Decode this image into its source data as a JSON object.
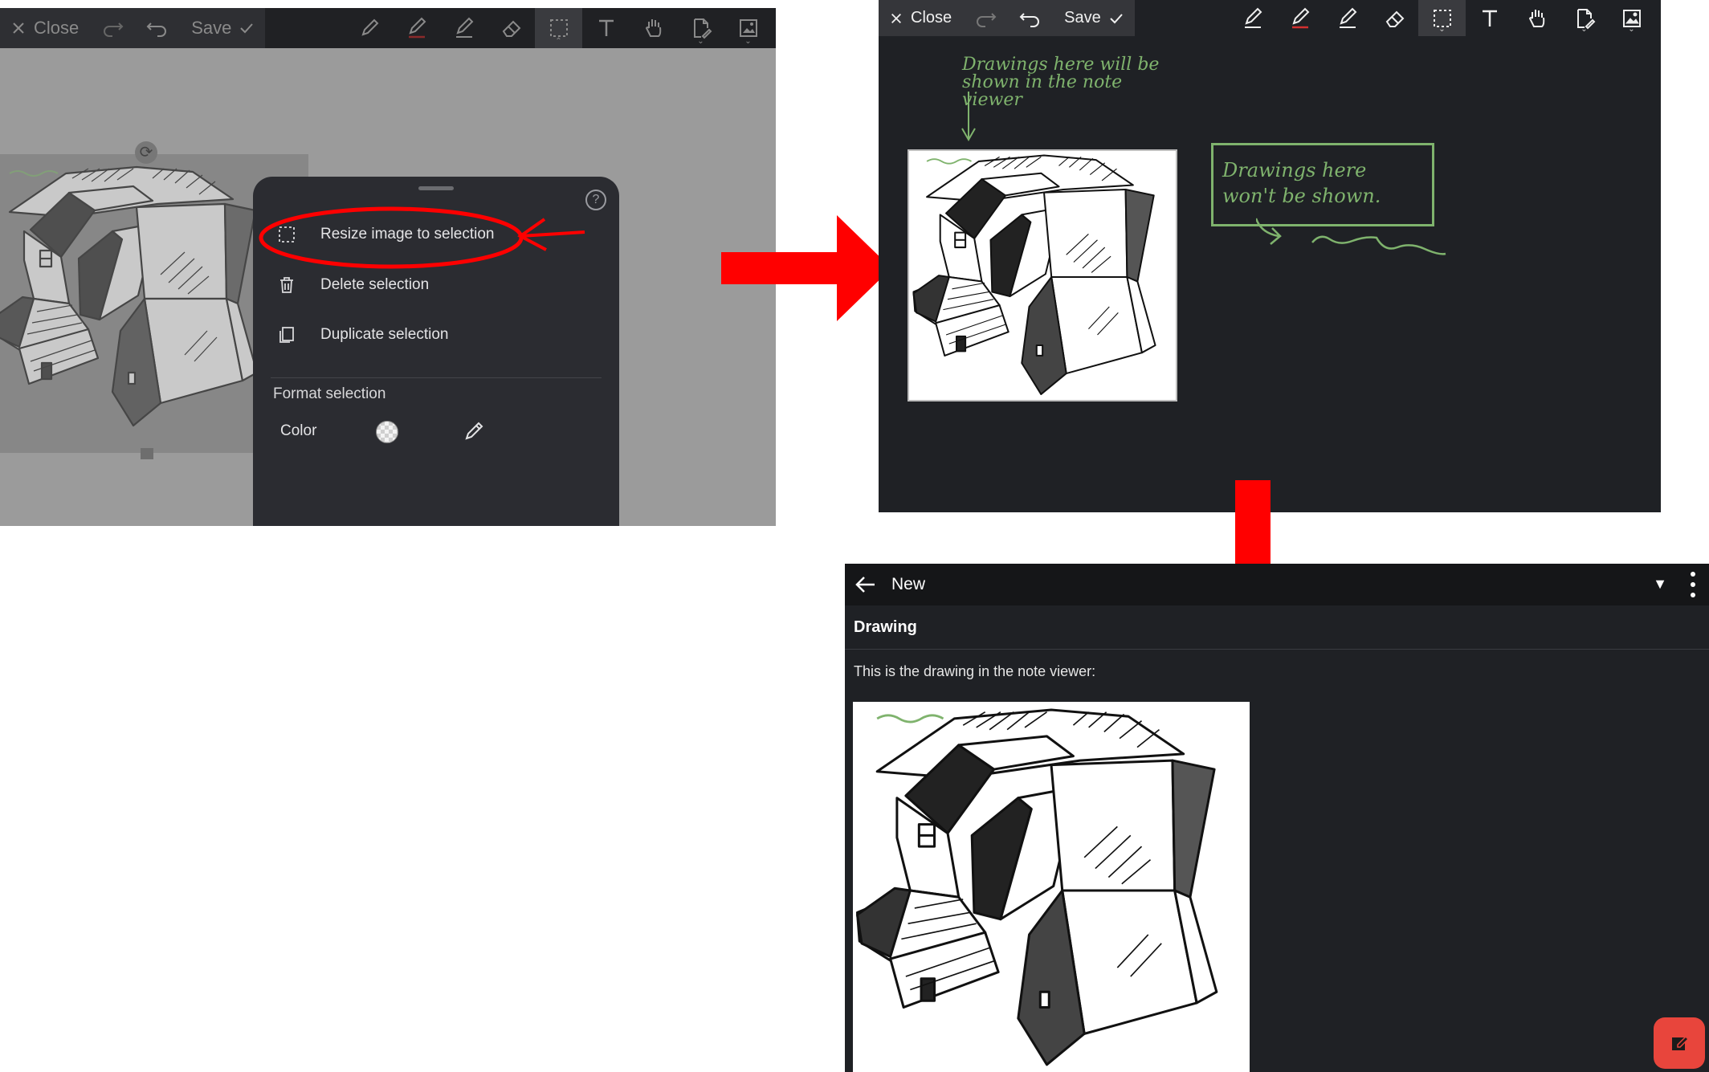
{
  "toolbar": {
    "close_label": "Close",
    "save_label": "Save"
  },
  "menu": {
    "resize_label": "Resize image to selection",
    "delete_label": "Delete selection",
    "duplicate_label": "Duplicate selection",
    "format_heading": "Format selection",
    "color_label": "Color"
  },
  "annotations": {
    "editor_note": "Drawings here will be shown in the note viewer",
    "outside_note": "Drawings here won't be shown."
  },
  "viewer": {
    "title": "New",
    "heading": "Drawing",
    "paragraph": "This is the drawing in the note viewer:"
  },
  "colors": {
    "highlight_red": "#ff0000",
    "arrow_red": "#ff0000",
    "handwriting_green": "#7fb36d",
    "fab_red": "#e8453c",
    "dark_bg": "#1f2125"
  },
  "icons": [
    "close-icon",
    "redo-icon",
    "undo-icon",
    "check-icon",
    "pen-icon",
    "pen-red-icon",
    "highlighter-icon",
    "eraser-icon",
    "selection-icon",
    "text-icon",
    "hand-icon",
    "page-edit-icon",
    "image-icon",
    "trash-icon",
    "duplicate-icon",
    "help-icon",
    "eyedropper-icon",
    "back-arrow-icon",
    "dropdown-icon",
    "kebab-icon",
    "edit-icon"
  ]
}
